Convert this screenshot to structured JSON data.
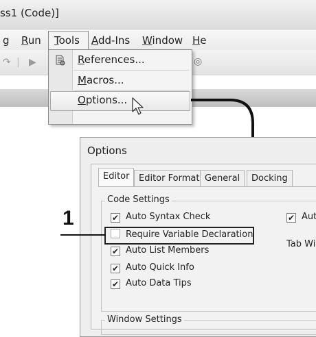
{
  "window": {
    "title": "ss1 (Code)]"
  },
  "menubar": {
    "items": [
      {
        "label": "g"
      },
      {
        "label": "Run",
        "accel": "R",
        "rest": "un"
      },
      {
        "label": "Tools",
        "accel": "T",
        "rest": "ools"
      },
      {
        "label": "Add-Ins",
        "accel": "A",
        "rest": "dd-Ins"
      },
      {
        "label": "Window",
        "accel": "W",
        "rest": "indow"
      },
      {
        "label": "He",
        "accel": "H",
        "rest": "e"
      }
    ]
  },
  "tools_menu": {
    "items": [
      {
        "label": "References...",
        "accel": "R",
        "rest": "eferences...",
        "icon": "references-icon"
      },
      {
        "label": "Macros...",
        "accel": "M",
        "rest": "acros..."
      },
      {
        "label": "Options...",
        "accel": "O",
        "rest": "ptions...",
        "hovered": true
      }
    ]
  },
  "dialog": {
    "title": "Options",
    "tabs": [
      "Editor",
      "Editor Format",
      "General",
      "Docking"
    ],
    "active_tab": "Editor",
    "code_settings": {
      "label": "Code Settings",
      "checkboxes": [
        {
          "label": "Auto Syntax Check",
          "checked": true
        },
        {
          "label": "Require Variable Declaration",
          "checked": false
        },
        {
          "label": "Auto List Members",
          "checked": true
        },
        {
          "label": "Auto Quick Info",
          "checked": true
        },
        {
          "label": "Auto Data Tips",
          "checked": true
        }
      ],
      "right_checkbox": {
        "label": "Aut",
        "checked": true
      },
      "tab_width_label": "Tab Wi"
    },
    "window_settings": {
      "label": "Window Settings"
    }
  },
  "callout": {
    "number": "1"
  },
  "colors": {
    "checkmark": "#222222",
    "connector": "#111111"
  }
}
